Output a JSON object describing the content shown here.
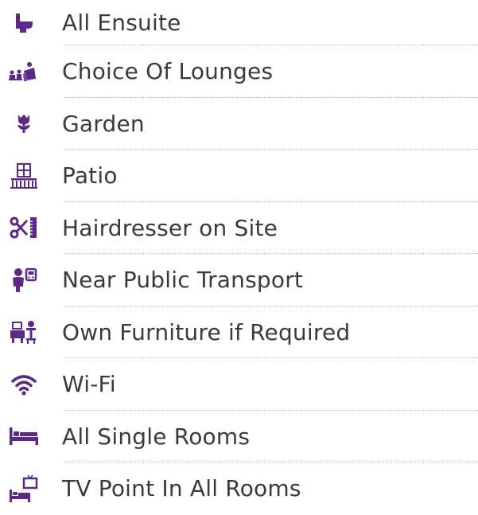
{
  "accent_color": "#5b2a86",
  "text_color": "#3a3a3a",
  "facilities": [
    {
      "label": "All Ensuite",
      "icon": "toilet-icon"
    },
    {
      "label": "Choice Of Lounges",
      "icon": "lounge-icon"
    },
    {
      "label": "Garden",
      "icon": "flower-icon"
    },
    {
      "label": "Patio",
      "icon": "patio-icon"
    },
    {
      "label": "Hairdresser on Site",
      "icon": "scissors-comb-icon"
    },
    {
      "label": "Near Public Transport",
      "icon": "bus-stop-icon"
    },
    {
      "label": "Own Furniture if Required",
      "icon": "furniture-icon"
    },
    {
      "label": "Wi-Fi",
      "icon": "wifi-icon"
    },
    {
      "label": "All Single Rooms",
      "icon": "single-bed-icon"
    },
    {
      "label": "TV Point In All Rooms",
      "icon": "bed-tv-icon"
    }
  ]
}
